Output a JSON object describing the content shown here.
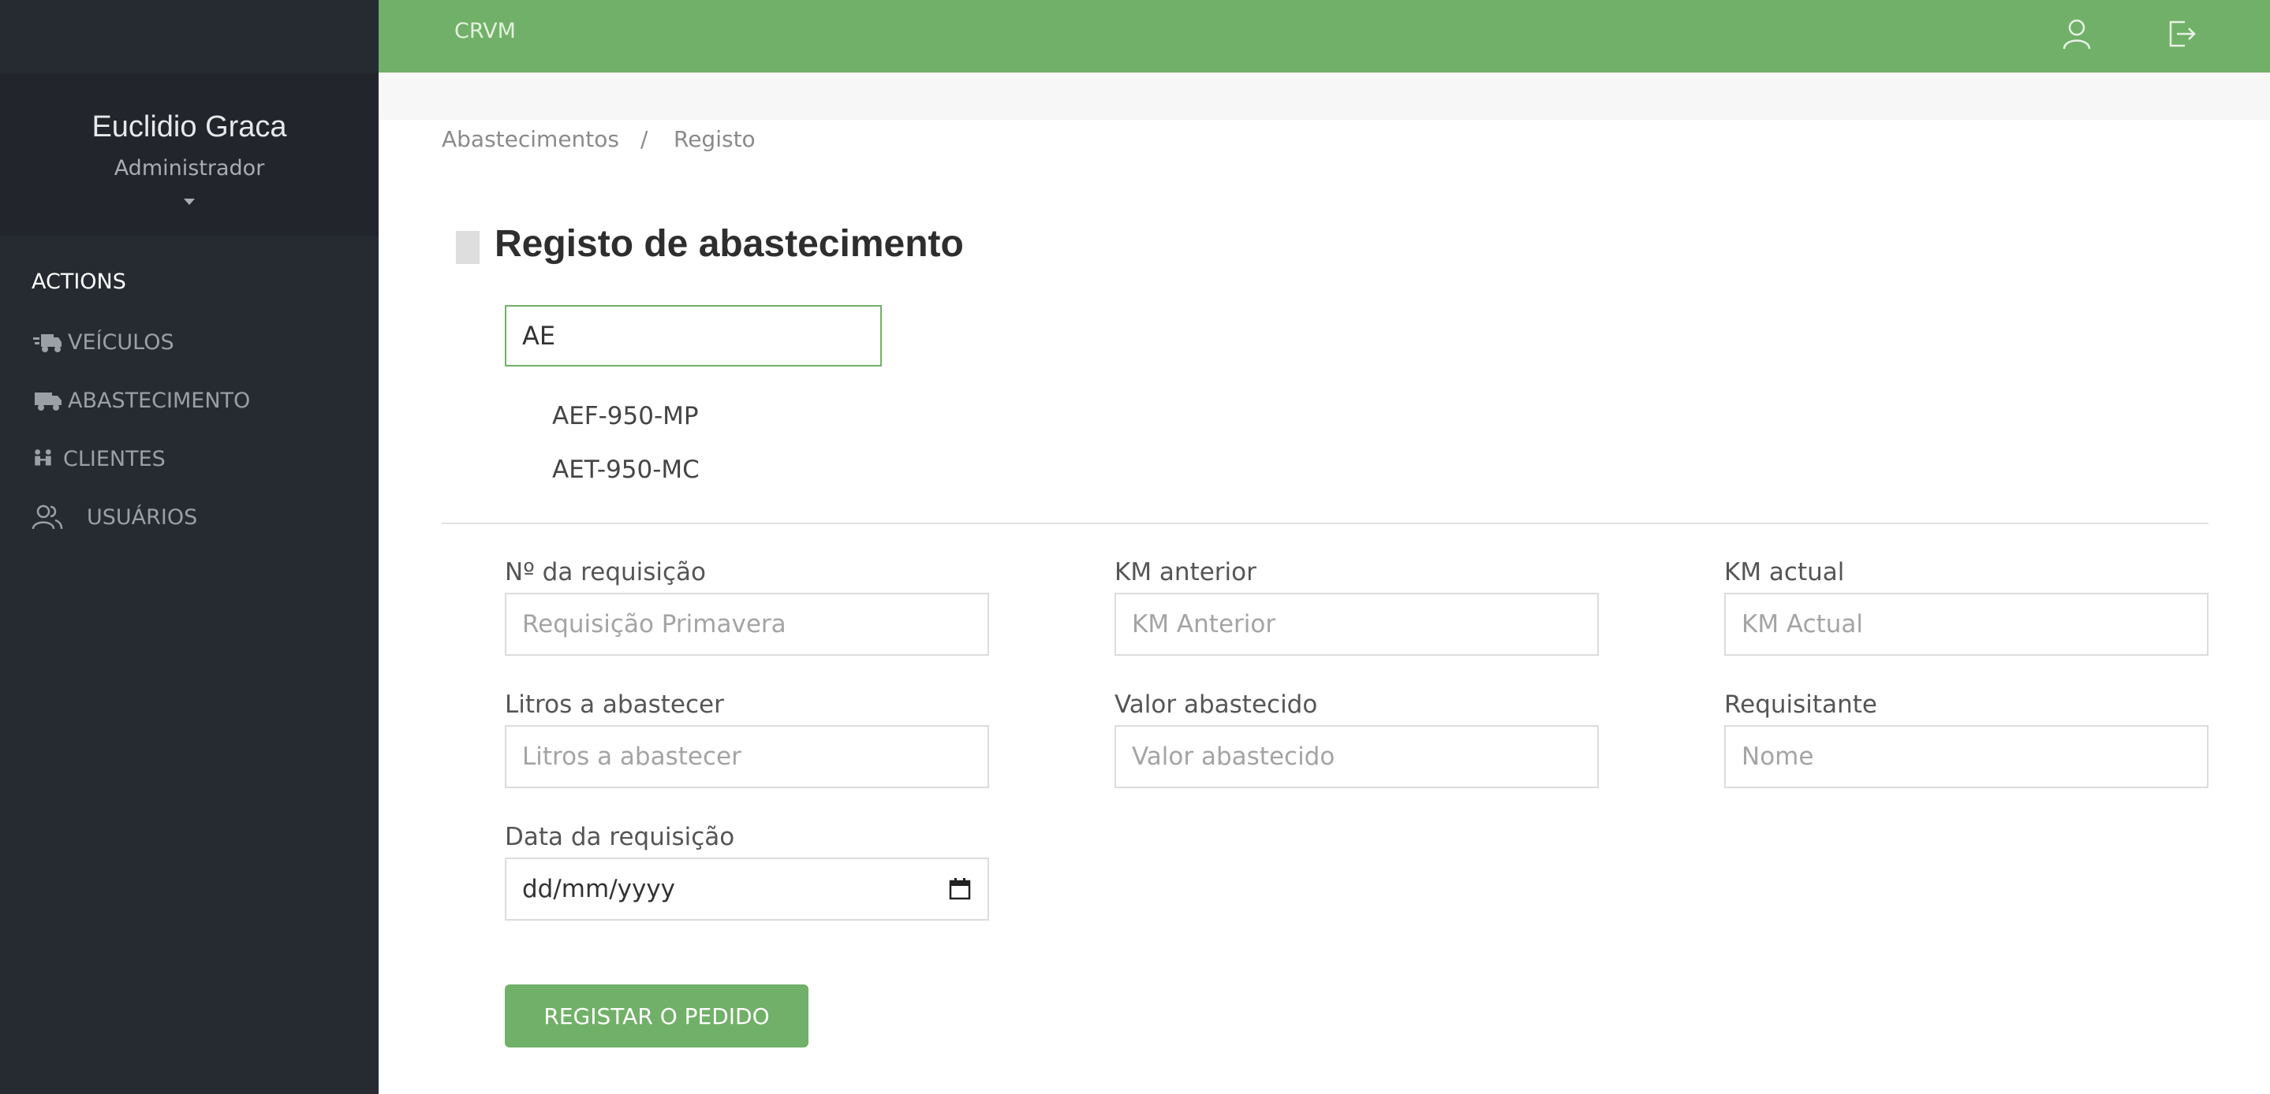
{
  "sidebar": {
    "user_name": "Euclidio Graca",
    "user_role": "Administrador",
    "section_label": "ACTIONS",
    "items": [
      {
        "label": "VEÍCULOS",
        "icon": "truck-fast-icon"
      },
      {
        "label": "ABASTECIMENTO",
        "icon": "truck-icon"
      },
      {
        "label": "CLIENTES",
        "icon": "people-arrows-icon"
      },
      {
        "label": "USUÁRIOS",
        "icon": "users-icon"
      }
    ]
  },
  "topbar": {
    "brand": "CRVM",
    "icons": [
      "user-icon",
      "logout-icon"
    ]
  },
  "breadcrumb": {
    "parent": "Abastecimentos",
    "separator": "/",
    "current": "Registo"
  },
  "page_title": "Registo de abastecimento",
  "search": {
    "value": "AE",
    "suggestions": [
      "AEF-950-MP",
      "AET-950-MC"
    ]
  },
  "form": {
    "requisicao": {
      "label": "Nº da requisição",
      "placeholder": "Requisição Primavera"
    },
    "km_anterior": {
      "label": "KM anterior",
      "placeholder": "KM Anterior"
    },
    "km_actual": {
      "label": "KM actual",
      "placeholder": "KM Actual"
    },
    "litros": {
      "label": "Litros a abastecer",
      "placeholder": "Litros a abastecer"
    },
    "valor": {
      "label": "Valor abastecido",
      "placeholder": "Valor abastecido"
    },
    "requisitante": {
      "label": "Requisitante",
      "placeholder": "Nome"
    },
    "data": {
      "label": "Data da requisição",
      "value": "dd/mm/yyyy",
      "icon": "calendar-icon"
    }
  },
  "submit_label": "REGISTAR O PEDIDO",
  "colors": {
    "accent": "#71b068",
    "sidebar": "#262b31"
  }
}
